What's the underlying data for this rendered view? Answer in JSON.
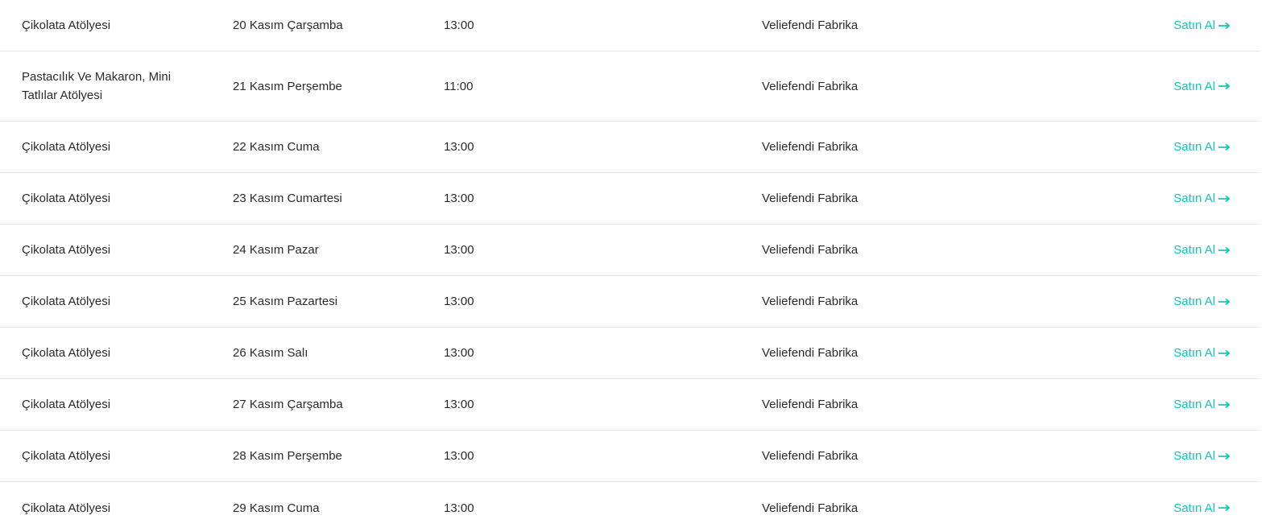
{
  "rows": [
    {
      "name": "Çikolata Atölyesi",
      "date": "20 Kasım Çarşamba",
      "time": "13:00",
      "venue": "Veliefendi Fabrika",
      "action": "Satın Al"
    },
    {
      "name": "Pastacılık Ve Makaron, Mini Tatlılar Atölyesi",
      "date": "21 Kasım Perşembe",
      "time": "11:00",
      "venue": "Veliefendi Fabrika",
      "action": "Satın Al"
    },
    {
      "name": "Çikolata Atölyesi",
      "date": "22 Kasım Cuma",
      "time": "13:00",
      "venue": "Veliefendi Fabrika",
      "action": "Satın Al"
    },
    {
      "name": "Çikolata Atölyesi",
      "date": "23 Kasım Cumartesi",
      "time": "13:00",
      "venue": "Veliefendi Fabrika",
      "action": "Satın Al"
    },
    {
      "name": "Çikolata Atölyesi",
      "date": "24 Kasım Pazar",
      "time": "13:00",
      "venue": "Veliefendi Fabrika",
      "action": "Satın Al"
    },
    {
      "name": "Çikolata Atölyesi",
      "date": "25 Kasım Pazartesi",
      "time": "13:00",
      "venue": "Veliefendi Fabrika",
      "action": "Satın Al"
    },
    {
      "name": "Çikolata Atölyesi",
      "date": "26 Kasım Salı",
      "time": "13:00",
      "venue": "Veliefendi Fabrika",
      "action": "Satın Al"
    },
    {
      "name": "Çikolata Atölyesi",
      "date": "27 Kasım Çarşamba",
      "time": "13:00",
      "venue": "Veliefendi Fabrika",
      "action": "Satın Al"
    },
    {
      "name": "Çikolata Atölyesi",
      "date": "28 Kasım Perşembe",
      "time": "13:00",
      "venue": "Veliefendi Fabrika",
      "action": "Satın Al"
    },
    {
      "name": "Çikolata Atölyesi",
      "date": "29 Kasım Cuma",
      "time": "13:00",
      "venue": "Veliefendi Fabrika",
      "action": "Satın Al"
    }
  ],
  "icons": {
    "buy": "arrow-right-icon"
  },
  "colors": {
    "accent": "#14c6b8",
    "text": "#2b2b2b",
    "divider": "#e6e6e6"
  }
}
